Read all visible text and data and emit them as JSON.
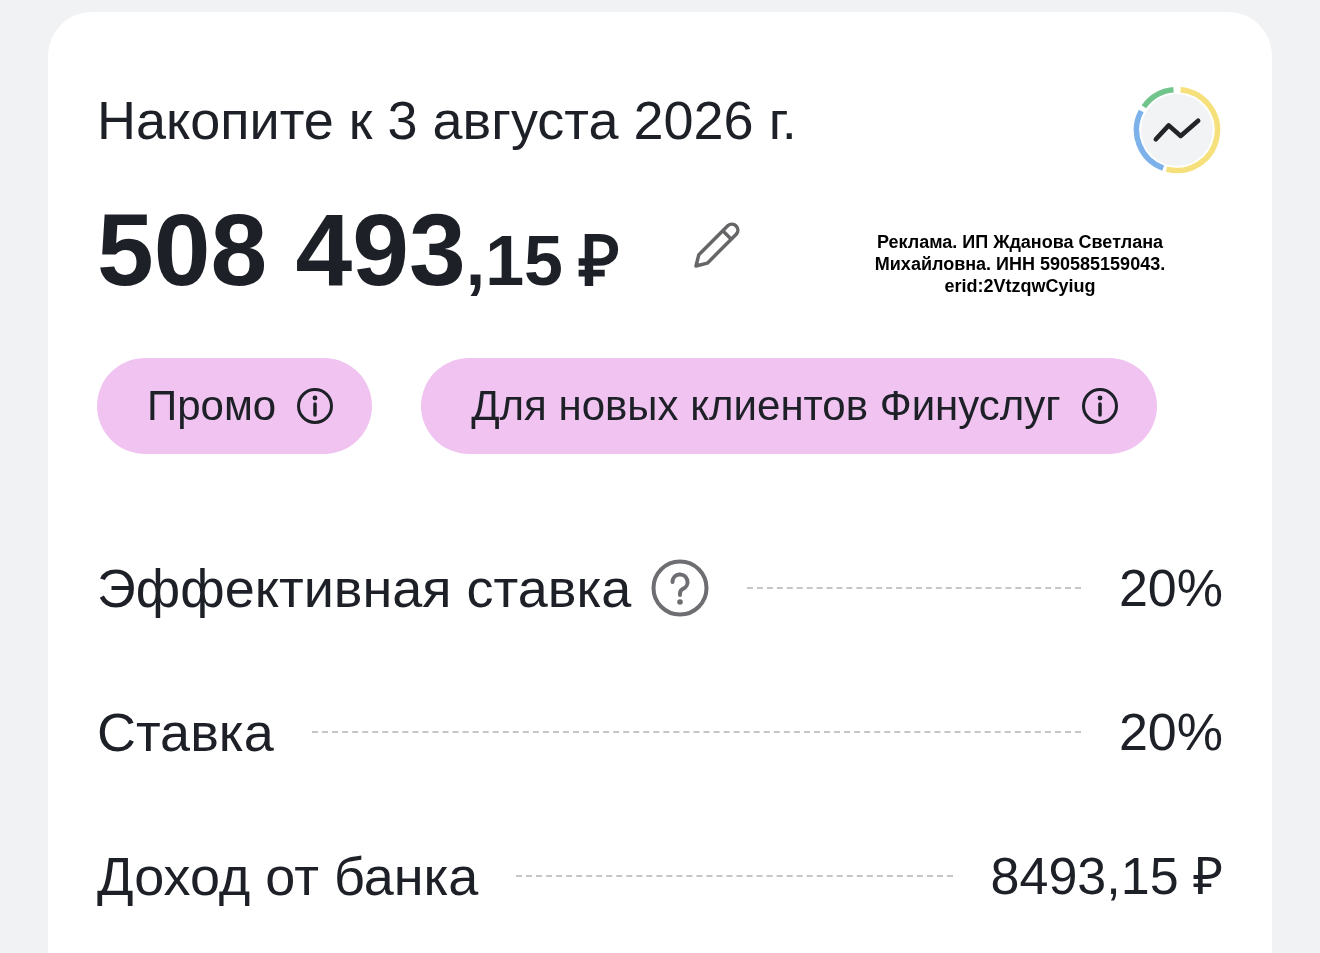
{
  "title": "Накопите к 3 августа 2026 г.",
  "amount": {
    "integer": "508 493",
    "fraction": ",15",
    "currency": "₽"
  },
  "ad_disclosure": {
    "lines": [
      "Реклама. ИП Жданова Светлана",
      "Михайловна. ИНН 590585159043.",
      "erid:2VtzqwCyiug"
    ]
  },
  "chips": [
    {
      "label": "Промо"
    },
    {
      "label": "Для новых клиентов Финуслуг"
    }
  ],
  "rows": [
    {
      "label": "Эффективная ставка",
      "help": true,
      "value": "20%"
    },
    {
      "label": "Ставка",
      "help": false,
      "value": "20%"
    },
    {
      "label": "Доход от банка",
      "help": false,
      "value": "8493,15 ₽"
    }
  ]
}
